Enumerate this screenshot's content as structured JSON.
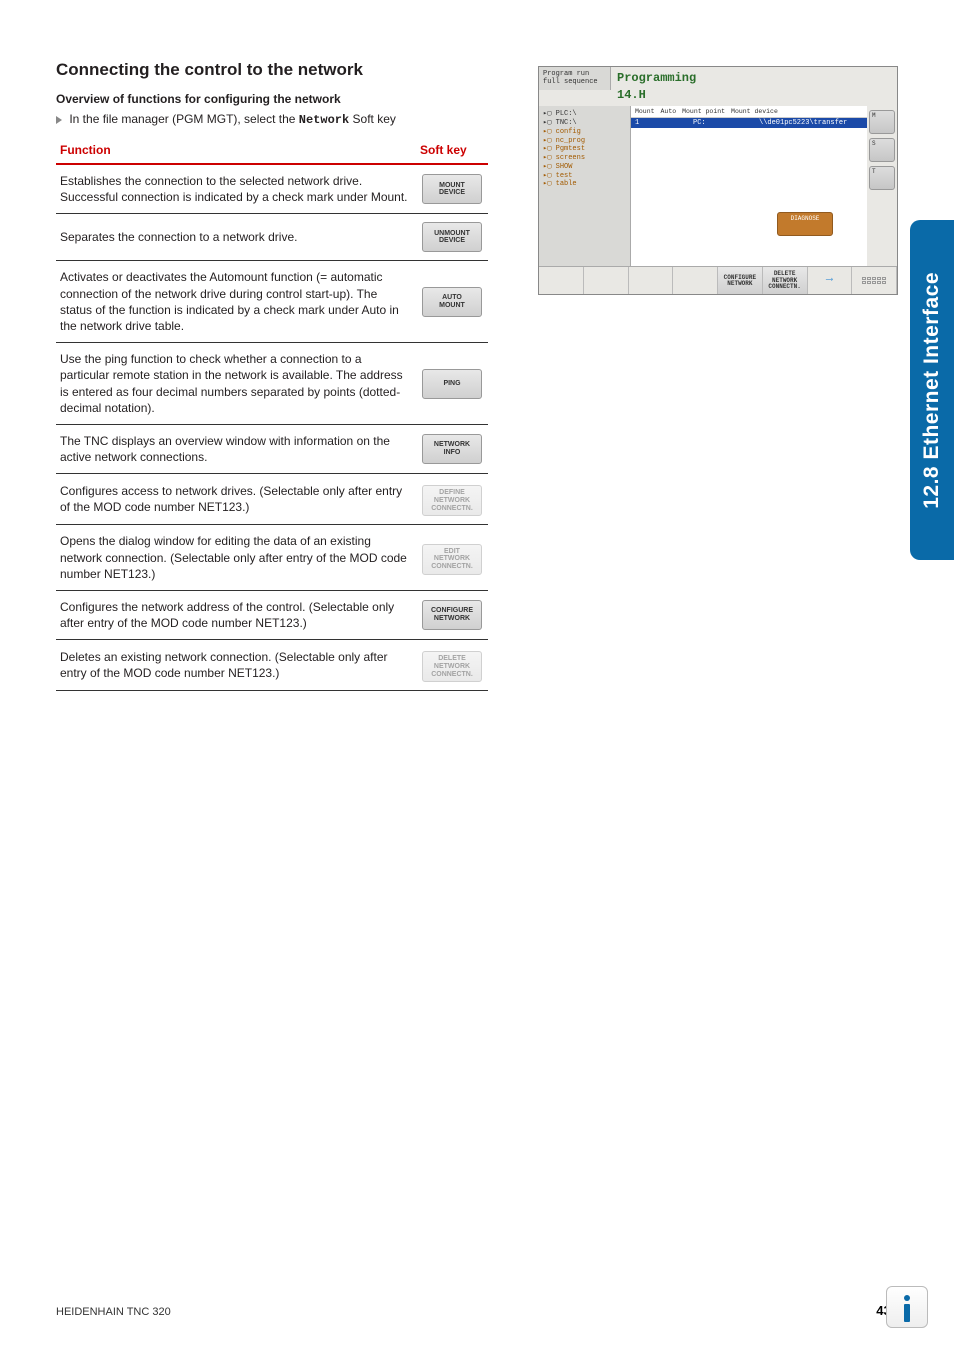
{
  "sideTab": "12.8 Ethernet Interface",
  "sectionTitle": "Connecting the control to the network",
  "subheading": "Overview of functions for configuring the network",
  "instruction_pre": "In the file manager (PGM MGT), select the ",
  "instruction_bold": "Network",
  "instruction_post": " Soft key",
  "table": {
    "header_func": "Function",
    "header_key": "Soft key",
    "rows": [
      {
        "desc": "Establishes the connection to the selected network drive. Successful connection is indicated by a check mark under Mount.",
        "key": "MOUNT\nDEVICE",
        "disabled": false
      },
      {
        "desc": "Separates the connection to a network drive.",
        "key": "UNMOUNT\nDEVICE",
        "disabled": false
      },
      {
        "desc": "Activates or deactivates the Automount function (= automatic connection of the network drive during control start-up). The status of the function is indicated by a check mark under Auto in the network drive table.",
        "key": "AUTO\nMOUNT",
        "disabled": false
      },
      {
        "desc": "Use the ping function to check whether a connection to a particular remote station in the network is available. The address is entered as four decimal numbers separated by points (dotted-decimal notation).",
        "key": "PING",
        "disabled": false
      },
      {
        "desc": "The TNC displays an overview window with information on the active network connections.",
        "key": "NETWORK\nINFO",
        "disabled": false
      },
      {
        "desc": "Configures access to network drives. (Selectable only after entry of the MOD code number NET123.)",
        "key": "DEFINE\nNETWORK\nCONNECTN.",
        "disabled": true
      },
      {
        "desc": "Opens the dialog window for editing the data of an existing network connection. (Selectable only after entry of the MOD code number NET123.)",
        "key": "EDIT\nNETWORK\nCONNECTN.",
        "disabled": true
      },
      {
        "desc": "Configures the network address of the control. (Selectable only after entry of the MOD code number NET123.)",
        "key": "CONFIGURE\nNETWORK",
        "disabled": false
      },
      {
        "desc": "Deletes an existing network connection. (Selectable only after entry of the MOD code number NET123.)",
        "key": "DELETE\nNETWORK\nCONNECTN.",
        "disabled": true
      }
    ]
  },
  "screenshot": {
    "modeLine1": "Program run",
    "modeLine2": "full sequence",
    "title": "Programming",
    "subtitle": "14.H",
    "tree": [
      "PLC:\\",
      "TNC:\\",
      " config",
      " nc_prog",
      "  Pgmtest",
      "  screens",
      "  SHOW",
      "  test",
      " table"
    ],
    "cols": [
      "Mount",
      "Auto",
      "Mount point",
      "Mount device"
    ],
    "row": {
      "mount": "1",
      "auto": "",
      "point": "PC:",
      "device": "\\\\de01pc5223\\transfer"
    },
    "sideBtns": [
      "M",
      "S",
      "T"
    ],
    "diag": "DIAGNOSE",
    "softkeys": [
      "",
      "",
      "",
      "",
      "CONFIGURE\nNETWORK",
      "DELETE\nNETWORK\nCONNECTN.",
      ""
    ]
  },
  "footer": {
    "left": "HEIDENHAIN TNC 320",
    "page": "433"
  }
}
